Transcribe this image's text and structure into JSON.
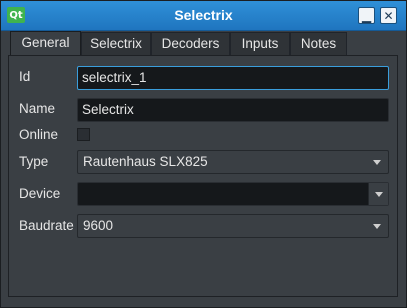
{
  "window": {
    "title": "Selectrix",
    "logo": "Qt",
    "minimize_glyph": "▁",
    "close_glyph": "✕"
  },
  "tabs": [
    "General",
    "Selectrix",
    "Decoders",
    "Inputs",
    "Notes"
  ],
  "form": {
    "id_label": "Id",
    "id_value": "selectrix_1",
    "name_label": "Name",
    "name_value": "Selectrix",
    "online_label": "Online",
    "type_label": "Type",
    "type_value": "Rautenhaus SLX825",
    "device_label": "Device",
    "device_value": "",
    "baudrate_label": "Baudrate",
    "baudrate_value": "9600"
  }
}
